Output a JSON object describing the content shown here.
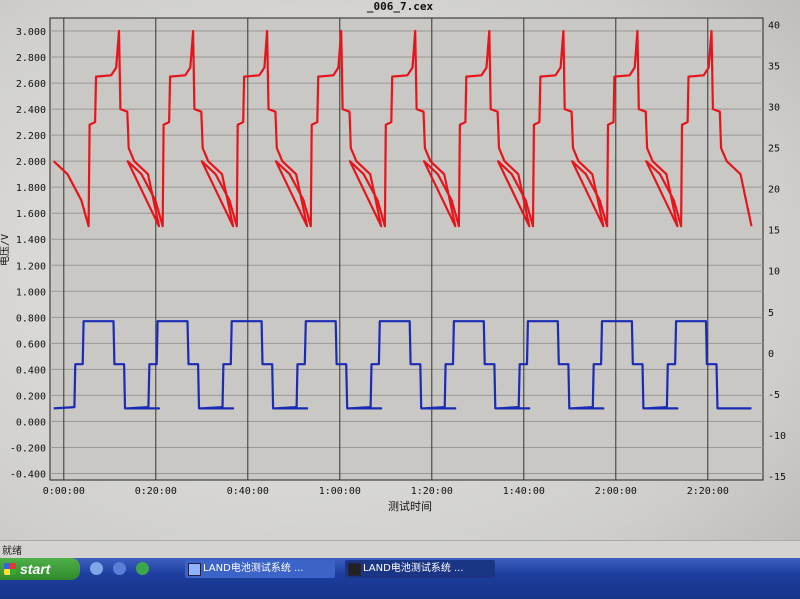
{
  "window": {
    "title": "_006_7.cex"
  },
  "chart_data": {
    "type": "line",
    "title": "_006_7.cex",
    "xlabel": "测试时间",
    "ylabel_left": "电压/V",
    "ylabel_right": "",
    "x_ticks": [
      "0:00:00",
      "0:20:00",
      "0:40:00",
      "1:00:00",
      "1:20:00",
      "1:40:00",
      "2:00:00",
      "2:20:00"
    ],
    "x_range_minutes": [
      -3,
      152
    ],
    "y_left_ticks": [
      "3.000",
      "2.800",
      "2.600",
      "2.400",
      "2.200",
      "2.000",
      "1.800",
      "1.600",
      "1.400",
      "1.200",
      "1.000",
      "0.800",
      "0.600",
      "0.400",
      "0.200",
      "0.000",
      "-0.200",
      "-0.400"
    ],
    "y_left_range": [
      -0.45,
      3.1
    ],
    "y_right_ticks": [
      "40",
      "35",
      "30",
      "25",
      "20",
      "15",
      "10",
      "5",
      "0",
      "-5",
      "-10",
      "-15"
    ],
    "y_right_range": [
      -15.5,
      40.8
    ],
    "grid": true,
    "cycle_period_minutes": 16.1,
    "series": [
      {
        "axis": "left",
        "color": "#e8141c",
        "cycle_shape_voltage": [
          [
            0.0,
            2.0
          ],
          [
            3.0,
            1.9
          ],
          [
            6.0,
            1.7
          ],
          [
            7.6,
            1.5
          ],
          [
            7.8,
            2.28
          ],
          [
            9.0,
            2.3
          ],
          [
            9.2,
            2.65
          ],
          [
            12.5,
            2.66
          ],
          [
            13.6,
            2.72
          ],
          [
            14.2,
            3.0
          ],
          [
            14.5,
            2.4
          ],
          [
            16.0,
            2.38
          ],
          [
            16.3,
            2.1
          ],
          [
            17.5,
            2.0
          ],
          [
            20.5,
            1.9
          ],
          [
            22.9,
            1.5
          ]
        ],
        "cycle_count": 9
      },
      {
        "axis": "left",
        "color": "#1c2bb4",
        "cycle_shape_current": [
          [
            0.0,
            0.1
          ],
          [
            4.5,
            0.11
          ],
          [
            4.7,
            0.44
          ],
          [
            6.3,
            0.44
          ],
          [
            6.5,
            0.77
          ],
          [
            13.0,
            0.77
          ],
          [
            13.2,
            0.44
          ],
          [
            15.3,
            0.44
          ],
          [
            15.5,
            0.1
          ],
          [
            22.9,
            0.1
          ]
        ],
        "cycle_count": 9
      }
    ]
  },
  "status_bar": {
    "text": "就绪"
  },
  "taskbar": {
    "start_label": "start",
    "items": [
      {
        "label": "LAND电池测试系统 ..."
      },
      {
        "label": "LAND电池测试系统 ..."
      }
    ]
  }
}
